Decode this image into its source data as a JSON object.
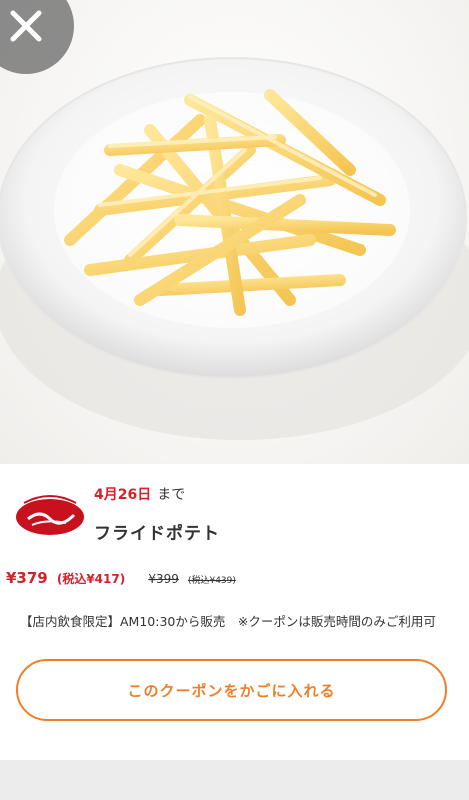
{
  "deadline": {
    "date": "4月26日",
    "suffix": "まで"
  },
  "product": {
    "title": "フライドポテト"
  },
  "price": {
    "sale": "¥379",
    "sale_tax": "(税込¥417)",
    "original": "¥399",
    "original_tax": "(税込¥439)"
  },
  "note": "【店内飲食限定】AM10:30から販売　※クーポンは販売時間のみご利用可",
  "cart_button": {
    "label": "このクーポンをかごに入れる"
  },
  "colors": {
    "accent_red": "#d6202a",
    "button_orange": "#f07f2a"
  },
  "icons": {
    "close": "close-icon",
    "logo": "brand-logo",
    "hero": "fries-photo"
  }
}
